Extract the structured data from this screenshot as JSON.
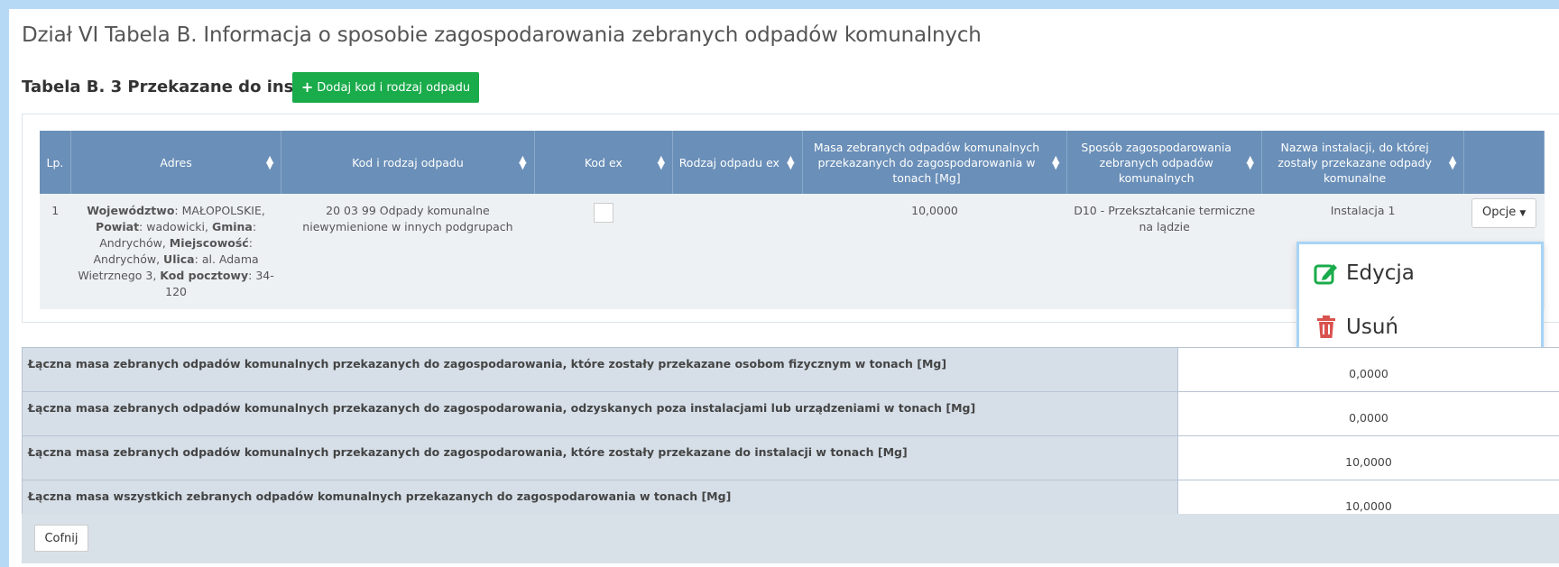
{
  "page": {
    "title": "Dział VI Tabela B. Informacja o sposobie zagospodarowania zebranych odpadów komunalnych"
  },
  "section": {
    "title": "Tabela B. 3 Przekazane do instalacji",
    "add_button": "Dodaj kod i rodzaj odpadu"
  },
  "table": {
    "headers": [
      "Lp.",
      "Adres",
      "Kod i rodzaj odpadu",
      "Kod ex",
      "Rodzaj odpadu ex",
      "Masa zebranych odpadów komunalnych przekazanych do zagospodarowania w tonach [Mg]",
      "Sposób zagospodarowania zebranych odpadów komunalnych",
      "Nazwa instalacji, do której zostały przekazane odpady komunalne",
      ""
    ],
    "rows": [
      {
        "lp": "1",
        "address": {
          "wojewodztwo_label": "Województwo",
          "wojewodztwo": "MAŁOPOLSKIE",
          "powiat_label": "Powiat",
          "powiat": "wadowicki",
          "gmina_label": "Gmina",
          "gmina": "Andrychów",
          "miejscowosc_label": "Miejscowość",
          "miejscowosc": "Andrychów",
          "ulica_label": "Ulica",
          "ulica": "al. Adama Wietrznego 3",
          "kod_label": "Kod pocztowy",
          "kod": "34-120"
        },
        "kod_rodzaj": "20 03 99 Odpady komunalne niewymienione w innych podgrupach",
        "kod_ex_checked": false,
        "rodzaj_ex": "",
        "masa": "10,0000",
        "sposob": "D10 - Przekształcanie termiczne na lądzie",
        "instalacja": "Instalacja 1",
        "options_button": "Opcje"
      }
    ]
  },
  "dropdown": {
    "edit_label": "Edycja",
    "delete_label": "Usuń",
    "edit_color": "#1aab4b",
    "delete_color": "#d9534f"
  },
  "summary": [
    {
      "label": "Łączna masa zebranych odpadów komunalnych przekazanych do zagospodarowania, które zostały przekazane osobom fizycznym w tonach [Mg]",
      "value": "0,0000"
    },
    {
      "label": "Łączna masa zebranych odpadów komunalnych przekazanych do zagospodarowania, odzyskanych poza instalacjami lub urządzeniami w tonach [Mg]",
      "value": "0,0000"
    },
    {
      "label": "Łączna masa zebranych odpadów komunalnych przekazanych do zagospodarowania, które zostały przekazane do instalacji w tonach [Mg]",
      "value": "10,0000"
    },
    {
      "label": "Łączna masa wszystkich zebranych odpadów komunalnych przekazanych do zagospodarowania w tonach [Mg]",
      "value": "10,0000"
    }
  ],
  "footer": {
    "back_button": "Cofnij"
  }
}
